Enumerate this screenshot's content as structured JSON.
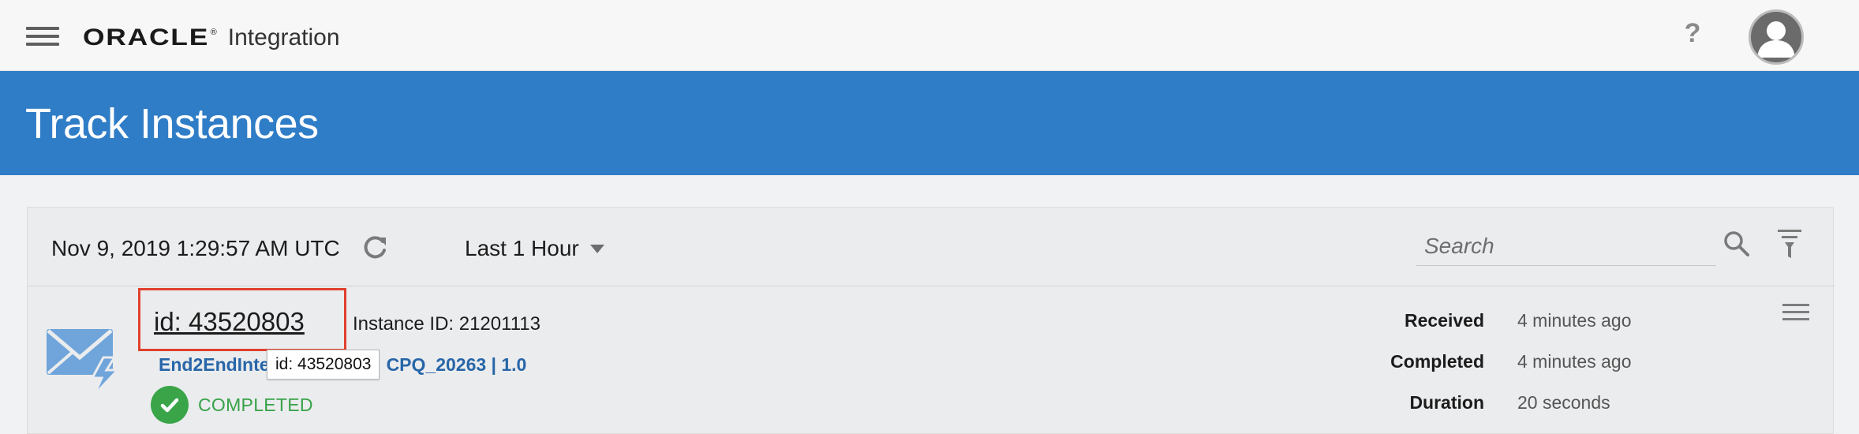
{
  "header": {
    "brand": "ORACLE",
    "brand_mark": "®",
    "product": "Integration",
    "help_label": "?",
    "icons": [
      "menu-icon",
      "help-icon",
      "user-avatar-icon"
    ]
  },
  "page": {
    "title": "Track Instances"
  },
  "toolbar": {
    "timestamp": "Nov 9, 2019 1:29:57 AM UTC",
    "range_label": "Last 1 Hour",
    "search_placeholder": "Search",
    "icons": [
      "refresh-icon",
      "caret-down-icon",
      "search-icon",
      "filter-icon"
    ]
  },
  "instance": {
    "id_label": "id: 43520803",
    "instance_id": "Instance ID: 21201113",
    "integration_prefix": "End2EndInte",
    "integration_suffix": "CPQ_20263 | 1.0",
    "tooltip": "id: 43520803",
    "status": "COMPLETED",
    "received_label": "Received",
    "received_value": "4 minutes ago",
    "completed_label": "Completed",
    "completed_value": "4 minutes ago",
    "duration_label": "Duration",
    "duration_value": "20 seconds"
  },
  "colors": {
    "accent_blue": "#307dc7",
    "link_blue": "#2766a8",
    "success_green": "#3aa548",
    "highlight_red": "#e0412e"
  }
}
